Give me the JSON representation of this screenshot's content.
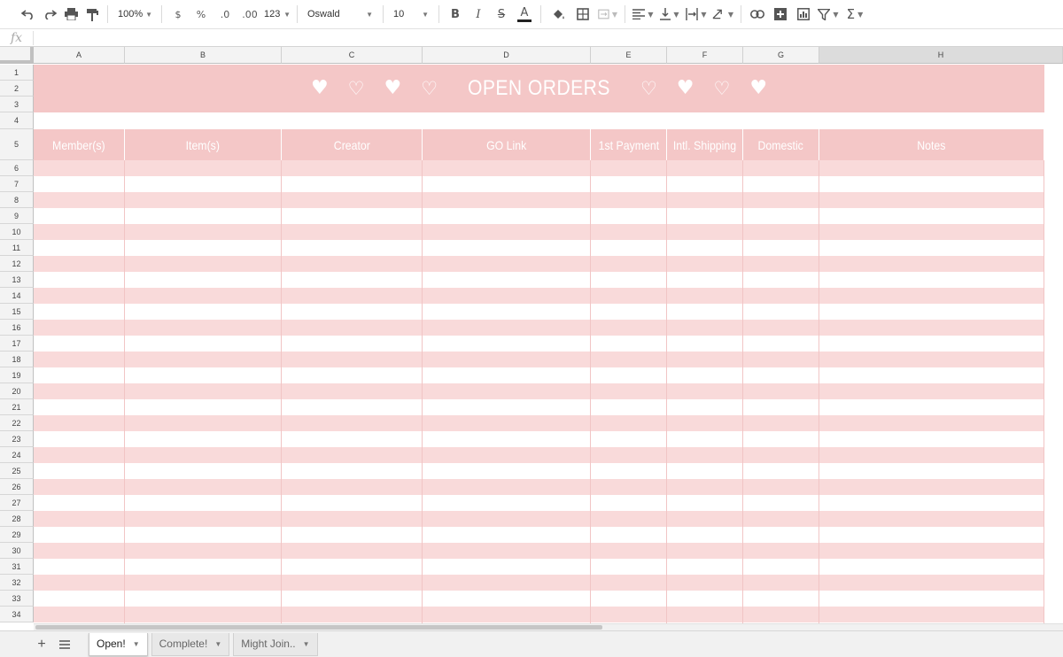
{
  "toolbar": {
    "undo_icon": "undo-icon",
    "zoom": "100%",
    "currency": "$",
    "percent": "%",
    "decrease_decimal": ".0",
    "increase_decimal": ".00",
    "more_formats": "123",
    "font": "Oswald",
    "font_size": "10",
    "bold": "B",
    "italic": "I",
    "strike": "S",
    "text_color_letter": "A",
    "sum": "Σ"
  },
  "formula": {
    "fx": "fx",
    "value": ""
  },
  "columns": [
    "A",
    "B",
    "C",
    "D",
    "E",
    "F",
    "G",
    "H"
  ],
  "rows": [
    "1",
    "2",
    "3",
    "4",
    "5",
    "6",
    "7",
    "8",
    "9",
    "10",
    "11",
    "12",
    "13",
    "14",
    "15",
    "16",
    "17",
    "18",
    "19",
    "20",
    "21",
    "22",
    "23",
    "24",
    "25",
    "26",
    "27",
    "28",
    "29",
    "30",
    "31",
    "32",
    "33",
    "34"
  ],
  "banner": {
    "title": "OPEN ORDERS",
    "heart_filled": "♥",
    "heart_outline": "♡",
    "color": "#f4c7c7"
  },
  "headers": [
    "Member(s)",
    "Item(s)",
    "Creator",
    "GO Link",
    "1st Payment",
    "Intl. Shipping",
    "Domestic",
    "Notes"
  ],
  "colors": {
    "pink": "#f4c7c7",
    "stripe": "#f9dada",
    "white": "#ffffff"
  },
  "tabs": [
    {
      "label": "Open!",
      "active": true
    },
    {
      "label": "Complete!",
      "active": false
    },
    {
      "label": "Might Join..",
      "active": false
    }
  ]
}
